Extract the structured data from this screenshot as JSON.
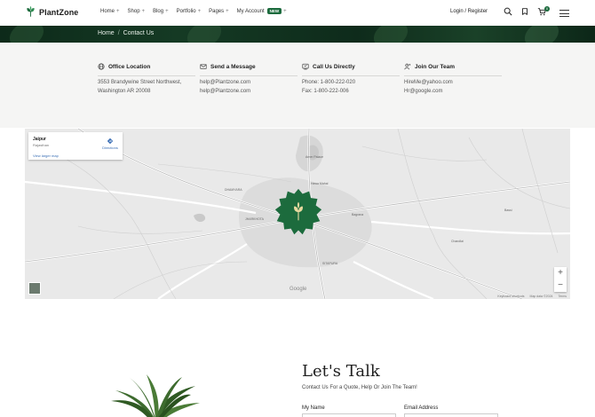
{
  "brand": {
    "name": "PlantZone",
    "accent": "#1c6b3d"
  },
  "nav": {
    "items": [
      {
        "label": "Home",
        "plus": "+"
      },
      {
        "label": "Shop",
        "plus": "+"
      },
      {
        "label": "Blog",
        "plus": "+"
      },
      {
        "label": "Portfolio",
        "plus": "+"
      },
      {
        "label": "Pages",
        "plus": "+"
      },
      {
        "label": "My Account",
        "plus": "+",
        "badge": "NEW"
      }
    ],
    "login": "Login / Register",
    "cart_count": "0"
  },
  "breadcrumb": {
    "home": "Home",
    "separator": "/",
    "current": "Contact Us"
  },
  "contact": [
    {
      "title": "Office Location",
      "icon": "globe-icon",
      "lines": [
        "3553 Brandywine Street Northwest,",
        "Washington AR 20008"
      ]
    },
    {
      "title": "Send a Message",
      "icon": "mail-icon",
      "lines": [
        "help@Plantzone.com",
        "help@Plantzone.com"
      ]
    },
    {
      "title": "Call Us Directly",
      "icon": "phone-icon",
      "lines": [
        "Phone: 1-800-222-020",
        "Fax: 1-800-222-006"
      ]
    },
    {
      "title": "Join Our Team",
      "icon": "team-icon",
      "lines": [
        "HireMe@yahoo.com",
        "Hr@google.com"
      ]
    }
  ],
  "map": {
    "place": "Jaipur",
    "region": "Rajasthan",
    "larger_map": "View larger map",
    "directions": "Directions",
    "zoom_in": "+",
    "zoom_out": "−",
    "google": "Google",
    "footer": [
      "Keyboard shortcuts",
      "Map data ©2024",
      "Terms"
    ],
    "labels": [
      {
        "t": "Amer Palace"
      },
      {
        "t": "Hawa Mahal"
      },
      {
        "t": "DHAMYARA"
      },
      {
        "t": "SITAPURA"
      },
      {
        "t": "JHARKHOTA"
      },
      {
        "t": "Bagrana"
      },
      {
        "t": "Chandlai"
      },
      {
        "t": "Bassi"
      }
    ]
  },
  "talk": {
    "title": "Let's Talk",
    "subtitle": "Contact Us For a Quote, Help Or Join The Team!",
    "fields": [
      {
        "label": "My Name"
      },
      {
        "label": "Email Address"
      }
    ]
  }
}
